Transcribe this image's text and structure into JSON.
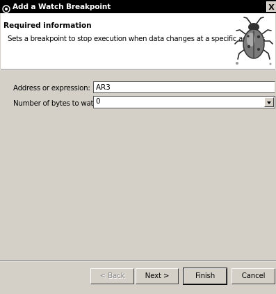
{
  "window": {
    "title": "Add a Watch Breakpoint",
    "close_label": "X"
  },
  "header": {
    "title": "Required information",
    "description": "Sets a breakpoint to stop execution when data changes at a specific address",
    "icon": "bug-icon"
  },
  "form": {
    "address_label": "Address or expression:",
    "address_value": "AR3",
    "bytes_label": "Number of bytes to watch:",
    "bytes_value": "0"
  },
  "buttons": {
    "back": "< Back",
    "next": "Next >",
    "finish": "Finish",
    "cancel": "Cancel"
  },
  "colors": {
    "title_bar": "#000000",
    "dialog_bg": "#d4d0c8",
    "header_bg": "#ffffff"
  }
}
